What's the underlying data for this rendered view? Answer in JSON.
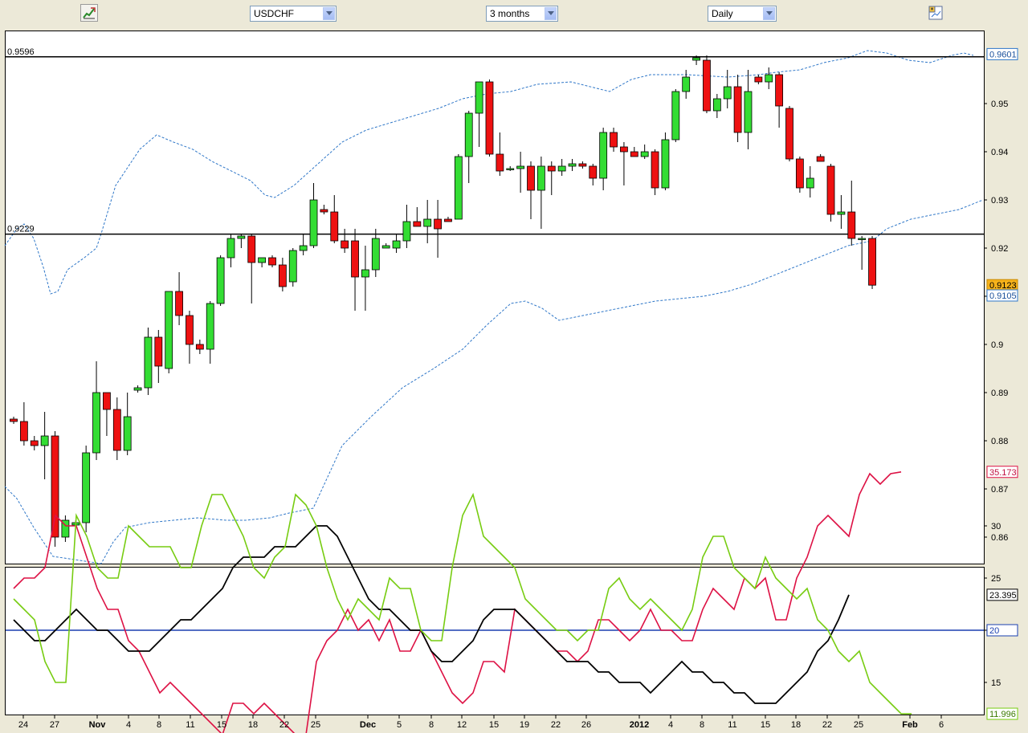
{
  "toolbar": {
    "symbol": "USDCHF",
    "period": "3 months",
    "interval": "Daily",
    "left_icon": "draw-tools-icon",
    "right_icon": "chart-options-icon"
  },
  "colors": {
    "up": "#33dd33",
    "down": "#ee1111",
    "bollinger": "#2f77c8",
    "adx": "#000000",
    "plus_di": "#77cc11",
    "minus_di": "#dd1144",
    "level_line": "#1a3fb0"
  },
  "chart_data": [
    {
      "type": "candlestick",
      "symbol": "USDCHF",
      "interval": "Daily",
      "ylim": [
        0.855,
        0.965
      ],
      "yticks": [
        "0.95",
        "0.94",
        "0.93",
        "0.92",
        "0.91",
        "0.9",
        "0.89",
        "0.88",
        "0.87",
        "0.86"
      ],
      "xticks": [
        "24",
        "27",
        "Nov",
        "4",
        "8",
        "11",
        "15",
        "18",
        "22",
        "25",
        "Dec",
        "5",
        "8",
        "12",
        "15",
        "19",
        "22",
        "26",
        "2012",
        "4",
        "8",
        "11",
        "15",
        "18",
        "22",
        "25",
        "Feb",
        "6"
      ],
      "hlines": [
        {
          "label": "0.9596",
          "value": 0.9597
        },
        {
          "label": "0.9229",
          "value": 0.9229
        }
      ],
      "last_price_label": "0.9123",
      "upper_band_label": "0.9601",
      "lower_band_label": "0.9105",
      "candles": [
        [
          0.8845,
          0.885,
          0.8835,
          0.884
        ],
        [
          0.884,
          0.888,
          0.879,
          0.88
        ],
        [
          0.88,
          0.881,
          0.878,
          0.879
        ],
        [
          0.879,
          0.886,
          0.872,
          0.881
        ],
        [
          0.881,
          0.882,
          0.858,
          0.86
        ],
        [
          0.86,
          0.8645,
          0.859,
          0.8635
        ],
        [
          0.8625,
          0.8635,
          0.862,
          0.863
        ],
        [
          0.863,
          0.879,
          0.861,
          0.8775
        ],
        [
          0.8775,
          0.8965,
          0.876,
          0.89
        ],
        [
          0.89,
          0.89,
          0.881,
          0.8865
        ],
        [
          0.8865,
          0.889,
          0.876,
          0.878
        ],
        [
          0.878,
          0.89,
          0.877,
          0.885
        ],
        [
          0.8905,
          0.8915,
          0.89,
          0.891
        ],
        [
          0.891,
          0.9035,
          0.8895,
          0.9015
        ],
        [
          0.9015,
          0.903,
          0.892,
          0.8955
        ],
        [
          0.895,
          0.911,
          0.894,
          0.911
        ],
        [
          0.911,
          0.915,
          0.904,
          0.906
        ],
        [
          0.906,
          0.907,
          0.896,
          0.9
        ],
        [
          0.9,
          0.901,
          0.898,
          0.899
        ],
        [
          0.899,
          0.909,
          0.896,
          0.9085
        ],
        [
          0.9085,
          0.9185,
          0.908,
          0.918
        ],
        [
          0.918,
          0.923,
          0.916,
          0.922
        ],
        [
          0.922,
          0.923,
          0.92,
          0.9225
        ],
        [
          0.9225,
          0.923,
          0.9085,
          0.917
        ],
        [
          0.917,
          0.918,
          0.916,
          0.918
        ],
        [
          0.918,
          0.9185,
          0.916,
          0.9165
        ],
        [
          0.9165,
          0.918,
          0.911,
          0.912
        ],
        [
          0.913,
          0.92,
          0.912,
          0.9195
        ],
        [
          0.9195,
          0.923,
          0.9185,
          0.9205
        ],
        [
          0.9205,
          0.9335,
          0.92,
          0.93
        ],
        [
          0.928,
          0.929,
          0.927,
          0.9275
        ],
        [
          0.9275,
          0.931,
          0.921,
          0.9215
        ],
        [
          0.9215,
          0.924,
          0.919,
          0.92
        ],
        [
          0.9215,
          0.924,
          0.907,
          0.914
        ],
        [
          0.914,
          0.9205,
          0.907,
          0.9155
        ],
        [
          0.9155,
          0.924,
          0.914,
          0.922
        ],
        [
          0.92,
          0.921,
          0.92,
          0.9205
        ],
        [
          0.92,
          0.923,
          0.919,
          0.9215
        ],
        [
          0.9215,
          0.929,
          0.92,
          0.9255
        ],
        [
          0.9255,
          0.9285,
          0.9245,
          0.9245
        ],
        [
          0.9245,
          0.93,
          0.921,
          0.926
        ],
        [
          0.926,
          0.93,
          0.918,
          0.924
        ],
        [
          0.926,
          0.9265,
          0.9255,
          0.9255
        ],
        [
          0.926,
          0.9395,
          0.926,
          0.939
        ],
        [
          0.939,
          0.9485,
          0.9335,
          0.948
        ],
        [
          0.948,
          0.9545,
          0.941,
          0.9545
        ],
        [
          0.9545,
          0.955,
          0.939,
          0.9395
        ],
        [
          0.9395,
          0.944,
          0.935,
          0.936
        ],
        [
          0.9365,
          0.937,
          0.936,
          0.9365
        ],
        [
          0.9365,
          0.94,
          0.9315,
          0.937
        ],
        [
          0.937,
          0.938,
          0.926,
          0.932
        ],
        [
          0.932,
          0.939,
          0.924,
          0.937
        ],
        [
          0.937,
          0.938,
          0.931,
          0.936
        ],
        [
          0.936,
          0.9385,
          0.935,
          0.937
        ],
        [
          0.937,
          0.9385,
          0.936,
          0.9375
        ],
        [
          0.9375,
          0.938,
          0.9365,
          0.937
        ],
        [
          0.937,
          0.9375,
          0.933,
          0.9345
        ],
        [
          0.9345,
          0.945,
          0.932,
          0.944
        ],
        [
          0.944,
          0.945,
          0.94,
          0.941
        ],
        [
          0.941,
          0.942,
          0.933,
          0.94
        ],
        [
          0.94,
          0.941,
          0.939,
          0.939
        ],
        [
          0.939,
          0.9415,
          0.9385,
          0.94
        ],
        [
          0.94,
          0.9405,
          0.931,
          0.9325
        ],
        [
          0.9325,
          0.944,
          0.932,
          0.9425
        ],
        [
          0.9425,
          0.953,
          0.942,
          0.9525
        ],
        [
          0.9525,
          0.957,
          0.951,
          0.9555
        ],
        [
          0.959,
          0.96,
          0.958,
          0.9595
        ],
        [
          0.959,
          0.96,
          0.948,
          0.9485
        ],
        [
          0.9485,
          0.952,
          0.947,
          0.951
        ],
        [
          0.951,
          0.957,
          0.949,
          0.9535
        ],
        [
          0.9535,
          0.956,
          0.942,
          0.944
        ],
        [
          0.944,
          0.957,
          0.9405,
          0.9525
        ],
        [
          0.9555,
          0.956,
          0.954,
          0.9545
        ],
        [
          0.9545,
          0.9575,
          0.953,
          0.956
        ],
        [
          0.956,
          0.9565,
          0.945,
          0.9495
        ],
        [
          0.949,
          0.9495,
          0.938,
          0.9385
        ],
        [
          0.9385,
          0.939,
          0.9315,
          0.9325
        ],
        [
          0.9325,
          0.937,
          0.9305,
          0.9345
        ],
        [
          0.939,
          0.9395,
          0.9385,
          0.938
        ],
        [
          0.937,
          0.9375,
          0.9255,
          0.927
        ],
        [
          0.927,
          0.931,
          0.924,
          0.9275
        ],
        [
          0.9275,
          0.934,
          0.9205,
          0.922
        ],
        [
          0.922,
          0.9225,
          0.9155,
          0.922
        ],
        [
          0.922,
          0.9225,
          0.9115,
          0.9123
        ]
      ],
      "bollinger_upper": [
        [
          0,
          0.9205
        ],
        [
          5,
          0.924
        ],
        [
          8,
          0.925
        ],
        [
          12,
          0.922
        ],
        [
          16,
          0.916
        ],
        [
          19,
          0.9105
        ],
        [
          22,
          0.911
        ],
        [
          26,
          0.9155
        ],
        [
          33,
          0.918
        ],
        [
          38,
          0.92
        ],
        [
          40,
          0.923
        ],
        [
          46,
          0.933
        ],
        [
          56,
          0.9405
        ],
        [
          63,
          0.9435
        ],
        [
          70,
          0.942
        ],
        [
          78,
          0.9405
        ],
        [
          86,
          0.938
        ],
        [
          92,
          0.9365
        ],
        [
          98,
          0.935
        ],
        [
          102,
          0.934
        ],
        [
          108,
          0.931
        ],
        [
          112,
          0.9305
        ],
        [
          120,
          0.933
        ],
        [
          130,
          0.9375
        ],
        [
          140,
          0.942
        ],
        [
          150,
          0.9445
        ],
        [
          160,
          0.946
        ],
        [
          170,
          0.9475
        ],
        [
          180,
          0.949
        ],
        [
          190,
          0.951
        ],
        [
          200,
          0.952
        ],
        [
          210,
          0.9525
        ],
        [
          221,
          0.954
        ],
        [
          235,
          0.9545
        ],
        [
          251,
          0.9525
        ],
        [
          260,
          0.955
        ],
        [
          268,
          0.956
        ],
        [
          283,
          0.956
        ],
        [
          300,
          0.9555
        ],
        [
          313,
          0.956
        ],
        [
          320,
          0.9565
        ],
        [
          330,
          0.957
        ],
        [
          340,
          0.9585
        ],
        [
          350,
          0.9595
        ],
        [
          358,
          0.961
        ],
        [
          366,
          0.9605
        ],
        [
          375,
          0.959
        ],
        [
          384,
          0.9585
        ],
        [
          393,
          0.96
        ],
        [
          398,
          0.9605
        ],
        [
          402,
          0.96
        ]
      ],
      "bollinger_lower": [
        [
          0,
          0.8705
        ],
        [
          5,
          0.868
        ],
        [
          12,
          0.862
        ],
        [
          20,
          0.856
        ],
        [
          40,
          0.8545
        ],
        [
          45,
          0.859
        ],
        [
          50,
          0.862
        ],
        [
          60,
          0.863
        ],
        [
          70,
          0.8635
        ],
        [
          80,
          0.864
        ],
        [
          92,
          0.8635
        ],
        [
          100,
          0.8635
        ],
        [
          110,
          0.864
        ],
        [
          118,
          0.865
        ],
        [
          128,
          0.866
        ],
        [
          140,
          0.879
        ],
        [
          152,
          0.885
        ],
        [
          165,
          0.891
        ],
        [
          178,
          0.895
        ],
        [
          190,
          0.899
        ],
        [
          200,
          0.904
        ],
        [
          210,
          0.9085
        ],
        [
          216,
          0.909
        ],
        [
          223,
          0.9075
        ],
        [
          230,
          0.905
        ],
        [
          240,
          0.906
        ],
        [
          250,
          0.907
        ],
        [
          260,
          0.908
        ],
        [
          270,
          0.909
        ],
        [
          280,
          0.9095
        ],
        [
          290,
          0.91
        ],
        [
          300,
          0.911
        ],
        [
          310,
          0.9125
        ],
        [
          320,
          0.9145
        ],
        [
          330,
          0.9165
        ],
        [
          340,
          0.9185
        ],
        [
          350,
          0.9205
        ],
        [
          360,
          0.9215
        ],
        [
          366,
          0.924
        ],
        [
          376,
          0.926
        ],
        [
          386,
          0.927
        ],
        [
          396,
          0.928
        ],
        [
          406,
          0.93
        ]
      ]
    },
    {
      "type": "line",
      "ylim": [
        10,
        36
      ],
      "yticks": [
        "30",
        "25",
        "20",
        "15"
      ],
      "level": 20,
      "level_label": "20",
      "series": [
        {
          "label": "35.173",
          "values": [
            24,
            25,
            25,
            26,
            31,
            30,
            30,
            27,
            24,
            22,
            22,
            19,
            18,
            16,
            14,
            15,
            14,
            13,
            12,
            11,
            10,
            13,
            13,
            12,
            13,
            12,
            11,
            10,
            10,
            17,
            19,
            20,
            22,
            20,
            21,
            19,
            21,
            18,
            18,
            20,
            18,
            16,
            14,
            13,
            14,
            17,
            17,
            16,
            22,
            21,
            20,
            19,
            18,
            18,
            17,
            18,
            21,
            21,
            20,
            19,
            20,
            22,
            20,
            20,
            19,
            19,
            22,
            24,
            23,
            22,
            25,
            24,
            25,
            21,
            21,
            25,
            27,
            30,
            31,
            30,
            29,
            33,
            35,
            34,
            35,
            35.173
          ]
        },
        {
          "label": "23.395",
          "values": [
            21,
            20,
            19,
            19,
            20,
            21,
            22,
            21,
            20,
            20,
            19,
            18,
            18,
            18,
            19,
            20,
            21,
            21,
            22,
            23,
            24,
            26,
            27,
            27,
            27,
            28,
            28,
            28,
            29,
            30,
            30,
            29,
            27,
            25,
            23,
            22,
            22,
            21,
            20,
            20,
            18,
            17,
            17,
            18,
            19,
            21,
            22,
            22,
            22,
            21,
            20,
            19,
            18,
            17,
            17,
            17,
            16,
            16,
            15,
            15,
            15,
            14,
            15,
            16,
            17,
            16,
            16,
            15,
            15,
            14,
            14,
            13,
            13,
            13,
            14,
            15,
            16,
            18,
            19,
            21,
            23.395
          ]
        },
        {
          "label": "11.996",
          "values": [
            23,
            22,
            21,
            17,
            15,
            15,
            31,
            29,
            26,
            25,
            25,
            30,
            29,
            28,
            28,
            28,
            26,
            26,
            30,
            33,
            33,
            31,
            29,
            26,
            25,
            27,
            28,
            33,
            32,
            30,
            26,
            23,
            21,
            23,
            22,
            21,
            25,
            24,
            24,
            20,
            19,
            19,
            26,
            31,
            33,
            29,
            28,
            27,
            26,
            23,
            22,
            21,
            20,
            20,
            19,
            20,
            20,
            24,
            25,
            23,
            22,
            23,
            22,
            21,
            20,
            22,
            27,
            29,
            29,
            26,
            25,
            24,
            27,
            25,
            24,
            23,
            24,
            21,
            20,
            18,
            17,
            18,
            15,
            14,
            13,
            12,
            11.996
          ]
        }
      ]
    }
  ]
}
